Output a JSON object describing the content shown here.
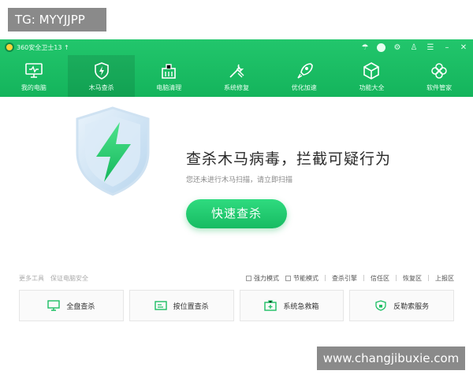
{
  "watermark_tag": "TG: MYYJJPP",
  "watermark_site": "www.changjibuxie.com",
  "app": {
    "title": "360安全卫士13 ↑",
    "window_controls": [
      "skin-icon",
      "avatar-icon",
      "settings-icon",
      "shirt-icon",
      "menu-icon",
      "minimize-icon",
      "close-icon"
    ]
  },
  "nav": [
    {
      "label": "我的电脑",
      "icon": "computer-icon"
    },
    {
      "label": "木马查杀",
      "icon": "shield-bolt-icon",
      "active": true
    },
    {
      "label": "电脑清理",
      "icon": "broom-icon"
    },
    {
      "label": "系统修复",
      "icon": "wrench-icon"
    },
    {
      "label": "优化加速",
      "icon": "rocket-icon"
    },
    {
      "label": "功能大全",
      "icon": "cube-icon"
    },
    {
      "label": "软件管家",
      "icon": "flower-icon"
    }
  ],
  "hero": {
    "headline": "查杀木马病毒，拦截可疑行为",
    "subline": "您还未进行木马扫描，请立即扫描",
    "scan_button": "快速查杀"
  },
  "toolbar": {
    "left": [
      "更多工具",
      "保证电脑安全"
    ],
    "options": [
      "强力模式",
      "节能模式"
    ],
    "links": [
      "查杀引擎",
      "信任区",
      "恢复区",
      "上报区"
    ]
  },
  "tools": [
    {
      "label": "全盘查杀",
      "icon": "monitor-scan-icon"
    },
    {
      "label": "按位置查杀",
      "icon": "folder-scan-icon"
    },
    {
      "label": "系统急救箱",
      "icon": "firstaid-icon"
    },
    {
      "label": "反勒索服务",
      "icon": "shield-lock-icon"
    }
  ],
  "colors": {
    "accent": "#1bbf63",
    "header": "#1fc06a"
  }
}
